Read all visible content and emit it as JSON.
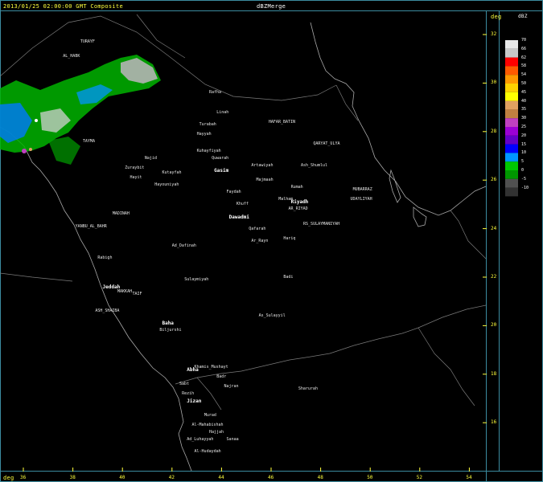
{
  "header": {
    "title": "2013/01/25 02:00:00 GMT Composite",
    "product": "dBZMerge",
    "deg_top": "deg",
    "deg_bottom": "deg"
  },
  "legend": {
    "units": "dBZ",
    "values": [
      "70",
      "66",
      "62",
      "58",
      "54",
      "50",
      "45",
      "40",
      "35",
      "30",
      "25",
      "20",
      "15",
      "10",
      "5",
      "0",
      "-5",
      "-10"
    ],
    "colors": [
      "#e8e8e8",
      "#c8c8c8",
      "#ff0000",
      "#ff5a00",
      "#ff9900",
      "#ffd200",
      "#ffff00",
      "#e0a060",
      "#c08040",
      "#c040c0",
      "#9c00d4",
      "#6400c8",
      "#0000ff",
      "#0096ff",
      "#00c800",
      "#009600",
      "#505050",
      "#323232"
    ]
  },
  "lat_ticks": [
    "32",
    "30",
    "28",
    "26",
    "24",
    "22",
    "20",
    "18",
    "16"
  ],
  "lon_ticks": [
    "36",
    "38",
    "40",
    "42",
    "44",
    "46",
    "48",
    "50",
    "52",
    "54"
  ],
  "places": [
    {
      "name": "TURAYF",
      "ln": 38.3,
      "la": 31.7
    },
    {
      "name": "AL_HABK",
      "ln": 37.6,
      "la": 31.1
    },
    {
      "name": "Rafha",
      "ln": 43.5,
      "la": 29.6
    },
    {
      "name": "Linah",
      "ln": 43.8,
      "la": 28.8
    },
    {
      "name": "HAFAR_BATIN",
      "ln": 45.9,
      "la": 28.4
    },
    {
      "name": "Turabah",
      "ln": 43.1,
      "la": 28.3
    },
    {
      "name": "Hayyah",
      "ln": 43.0,
      "la": 27.9
    },
    {
      "name": "QARYAT_ULYA",
      "ln": 47.7,
      "la": 27.5
    },
    {
      "name": "TAYMA",
      "ln": 38.4,
      "la": 27.6
    },
    {
      "name": "Kuhayfiyah",
      "ln": 43.0,
      "la": 27.2
    },
    {
      "name": "Najid",
      "ln": 40.9,
      "la": 26.9
    },
    {
      "name": "Quwarah",
      "ln": 43.6,
      "la": 26.9
    },
    {
      "name": "Artawiyah",
      "ln": 45.2,
      "la": 26.6
    },
    {
      "name": "Ash_Shumlul",
      "ln": 47.2,
      "la": 26.6
    },
    {
      "name": "Zuraybit",
      "ln": 40.1,
      "la": 26.5
    },
    {
      "name": "Kutayfah",
      "ln": 41.6,
      "la": 26.3
    },
    {
      "name": "Hayit",
      "ln": 40.3,
      "la": 26.1
    },
    {
      "name": "Majmaah",
      "ln": 45.4,
      "la": 26.0
    },
    {
      "name": "Hayouniyah",
      "ln": 41.3,
      "la": 25.8
    },
    {
      "name": "Rumah",
      "ln": 46.8,
      "la": 25.7
    },
    {
      "name": "MUBARRAZ",
      "ln": 49.3,
      "la": 25.6
    },
    {
      "name": "UDAYLIYAH",
      "ln": 49.2,
      "la": 25.2
    },
    {
      "name": "Faydah",
      "ln": 44.2,
      "la": 25.5
    },
    {
      "name": "Malham",
      "ln": 46.3,
      "la": 25.2
    },
    {
      "name": "Khuff",
      "ln": 44.6,
      "la": 25.0
    },
    {
      "name": "AR_RIYAD",
      "ln": 46.7,
      "la": 24.8
    },
    {
      "name": "MADINAH",
      "ln": 39.6,
      "la": 24.6
    },
    {
      "name": "YANBU_AL_BAHR",
      "ln": 38.1,
      "la": 24.1
    },
    {
      "name": "Qafarah",
      "ln": 45.1,
      "la": 24.0
    },
    {
      "name": "RS_SULAYMANIYAH",
      "ln": 47.3,
      "la": 24.2
    },
    {
      "name": "Hariq",
      "ln": 46.5,
      "la": 23.6
    },
    {
      "name": "Ar_Rayn",
      "ln": 45.2,
      "la": 23.5
    },
    {
      "name": "Ad_Dafinah",
      "ln": 42.0,
      "la": 23.3
    },
    {
      "name": "Rabigh",
      "ln": 39.0,
      "la": 22.8
    },
    {
      "name": "Badi",
      "ln": 46.5,
      "la": 22.0
    },
    {
      "name": "Sulaymiyah",
      "ln": 42.5,
      "la": 21.9
    },
    {
      "name": "MAKKAH",
      "ln": 39.8,
      "la": 21.4
    },
    {
      "name": "TAIF",
      "ln": 40.4,
      "la": 21.3
    },
    {
      "name": "ASH_SHAIBA",
      "ln": 38.9,
      "la": 20.6
    },
    {
      "name": "As_Sulayyil",
      "ln": 45.5,
      "la": 20.4
    },
    {
      "name": "Biljurshi",
      "ln": 41.5,
      "la": 19.8
    },
    {
      "name": "Khamis_Mushayt",
      "ln": 42.9,
      "la": 18.3
    },
    {
      "name": "Badr",
      "ln": 43.8,
      "la": 17.9
    },
    {
      "name": "Najran",
      "ln": 44.1,
      "la": 17.5
    },
    {
      "name": "Sharurah",
      "ln": 47.1,
      "la": 17.4
    },
    {
      "name": "Sabt",
      "ln": 42.3,
      "la": 17.6
    },
    {
      "name": "Rezih",
      "ln": 42.4,
      "la": 17.2
    },
    {
      "name": "Murad",
      "ln": 43.3,
      "la": 16.3
    },
    {
      "name": "Al-Mahabishah",
      "ln": 42.8,
      "la": 15.9
    },
    {
      "name": "Hajjah",
      "ln": 43.5,
      "la": 15.6
    },
    {
      "name": "Ad_Luhayyah",
      "ln": 42.6,
      "la": 15.3
    },
    {
      "name": "Sanaa",
      "ln": 44.2,
      "la": 15.3
    },
    {
      "name": "Al-Hudaydah",
      "ln": 42.9,
      "la": 14.8
    }
  ],
  "major_places": [
    {
      "name": "Gasim",
      "ln": 43.7,
      "la": 26.4
    },
    {
      "name": "Riyadh",
      "ln": 46.8,
      "la": 25.1
    },
    {
      "name": "Dawadmi",
      "ln": 44.3,
      "la": 24.5
    },
    {
      "name": "Jeddah",
      "ln": 39.2,
      "la": 21.6
    },
    {
      "name": "Abha",
      "ln": 42.6,
      "la": 18.2
    },
    {
      "name": "Baha",
      "ln": 41.6,
      "la": 20.1
    },
    {
      "name": "Jizan",
      "ln": 42.6,
      "la": 16.9
    }
  ]
}
